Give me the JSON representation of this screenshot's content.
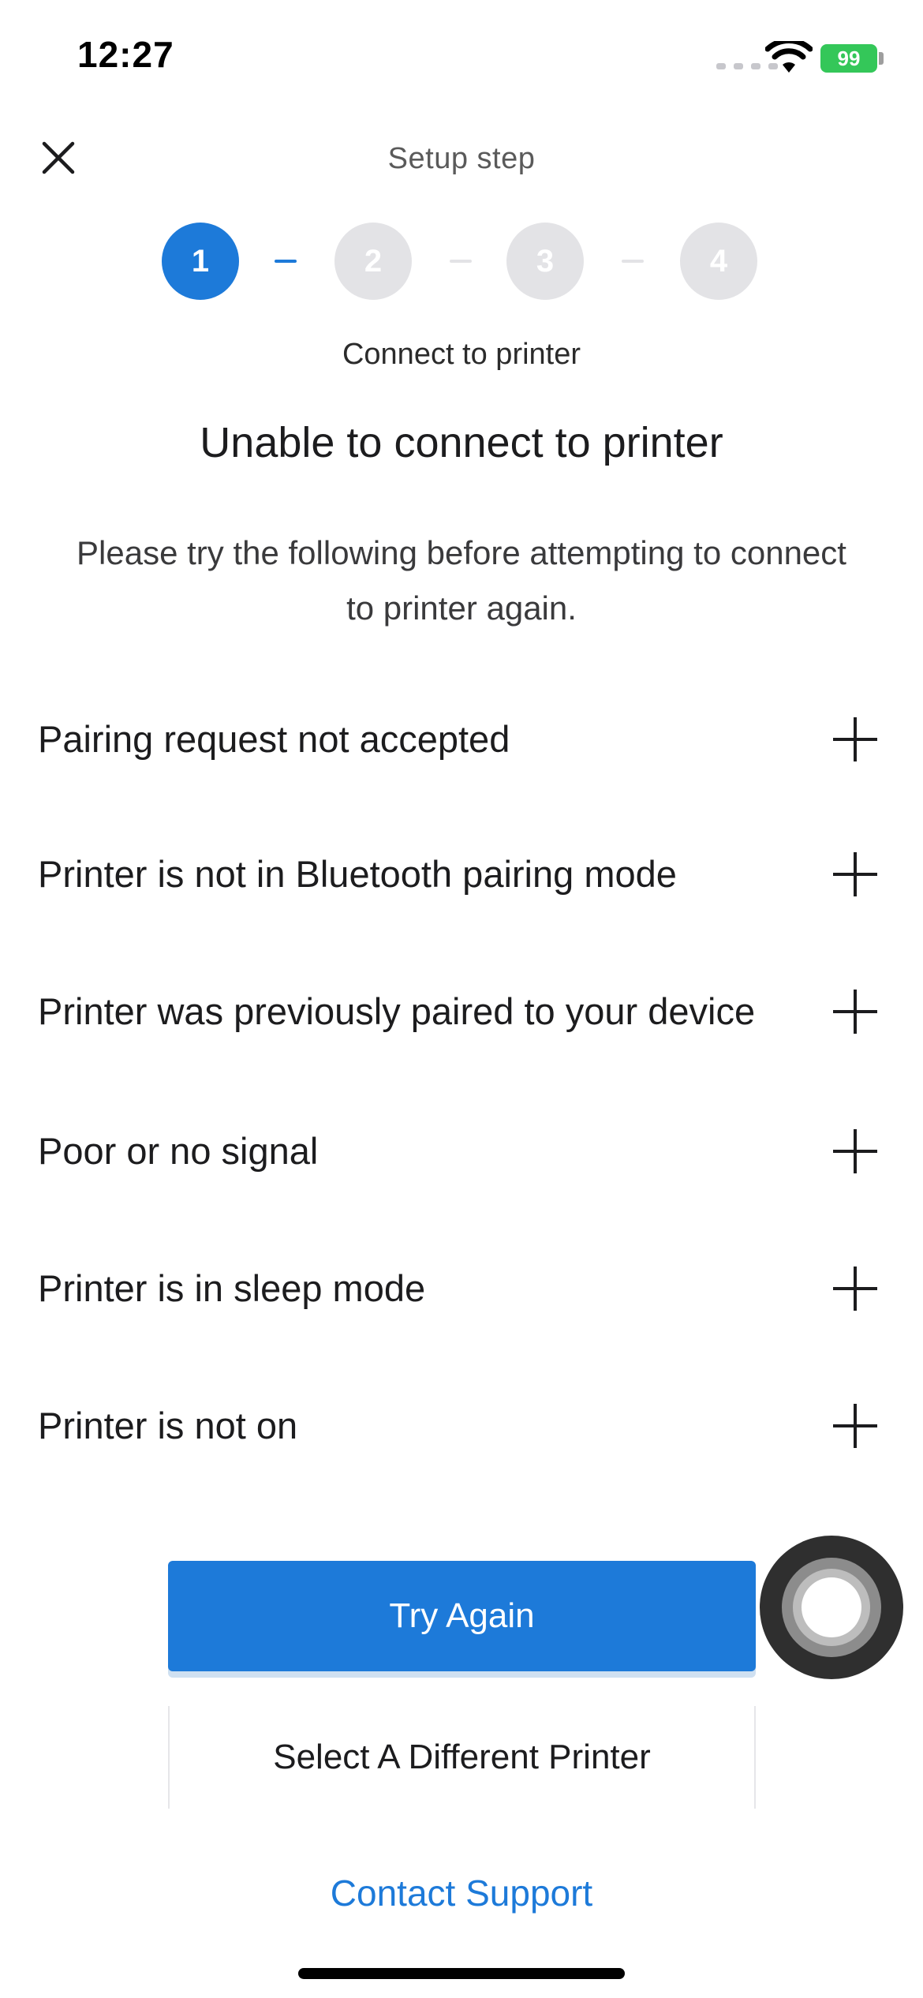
{
  "status_bar": {
    "time": "12:27",
    "battery": "99"
  },
  "header": {
    "title": "Setup step",
    "close_icon": "close-icon"
  },
  "stepper": {
    "steps": [
      "1",
      "2",
      "3",
      "4"
    ],
    "current_step": 1,
    "current_label": "Connect to printer",
    "accent_color": "#1d7ad9",
    "inactive_color": "#e3e3e6"
  },
  "content": {
    "title": "Unable to connect to printer",
    "description": "Please try the following before attempting to connect to printer again."
  },
  "troubleshooting": [
    {
      "label": "Pairing request not accepted",
      "icon": "plus-icon"
    },
    {
      "label": "Printer is not in Bluetooth pairing mode",
      "icon": "plus-icon"
    },
    {
      "label": "Printer was previously paired to your device",
      "icon": "plus-icon"
    },
    {
      "label": "Poor or no signal",
      "icon": "plus-icon"
    },
    {
      "label": "Printer is in sleep mode",
      "icon": "plus-icon"
    },
    {
      "label": "Printer is not on",
      "icon": "plus-icon"
    }
  ],
  "actions": {
    "primary": "Try Again",
    "secondary": "Select A Different Printer",
    "link": "Contact Support"
  }
}
